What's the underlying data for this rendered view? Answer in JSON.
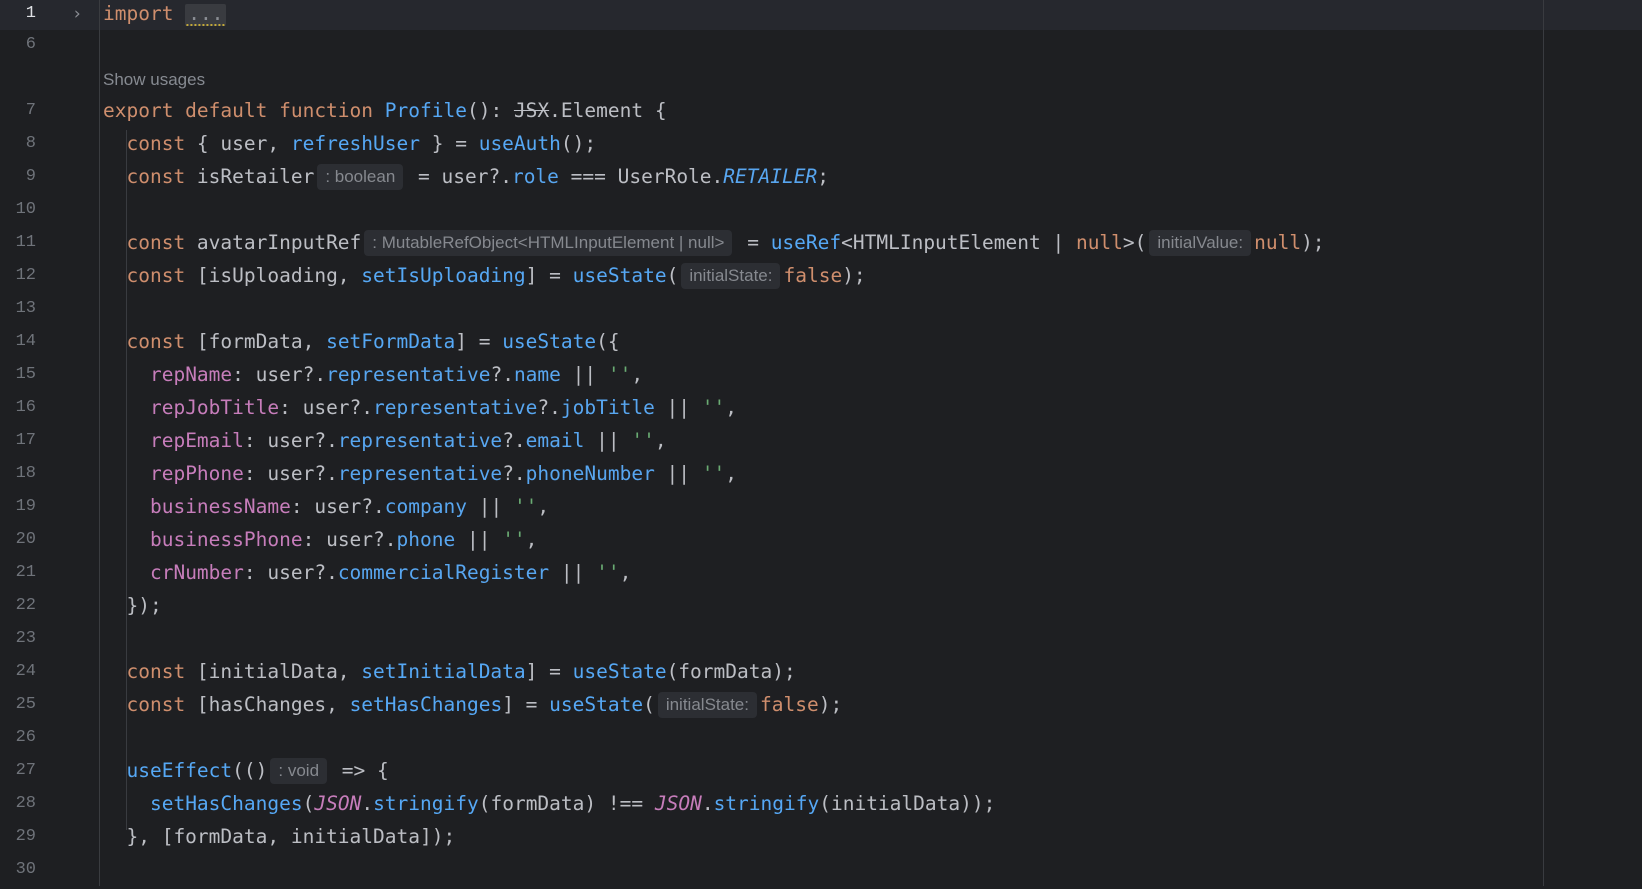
{
  "editor": {
    "code_vision": "Show usages",
    "fold_placeholder": "...",
    "lines": [
      {
        "num": "1",
        "text": "import "
      },
      {
        "num": "6",
        "text": ""
      },
      {
        "num": "7",
        "text": "export default function Profile(): JSX.Element {"
      },
      {
        "num": "8",
        "text": "  const { user, refreshUser } = useAuth();"
      },
      {
        "num": "9",
        "text": "  const isRetailer = user?.role === UserRole.RETAILER;",
        "hint": ": boolean"
      },
      {
        "num": "10",
        "text": ""
      },
      {
        "num": "11",
        "text": "  const avatarInputRef = useRef<HTMLInputElement | null>(null);",
        "hints": [
          ": MutableRefObject<HTMLInputElement | null>",
          "initialValue:"
        ]
      },
      {
        "num": "12",
        "text": "  const [isUploading, setIsUploading] = useState(false);",
        "hint": "initialState:"
      },
      {
        "num": "13",
        "text": ""
      },
      {
        "num": "14",
        "text": "  const [formData, setFormData] = useState({"
      },
      {
        "num": "15",
        "text": "    repName: user?.representative?.name || '',"
      },
      {
        "num": "16",
        "text": "    repJobTitle: user?.representative?.jobTitle || '',"
      },
      {
        "num": "17",
        "text": "    repEmail: user?.representative?.email || '',"
      },
      {
        "num": "18",
        "text": "    repPhone: user?.representative?.phoneNumber || '',"
      },
      {
        "num": "19",
        "text": "    businessName: user?.company || '',"
      },
      {
        "num": "20",
        "text": "    businessPhone: user?.phone || '',"
      },
      {
        "num": "21",
        "text": "    crNumber: user?.commercialRegister || '',"
      },
      {
        "num": "22",
        "text": "  });"
      },
      {
        "num": "23",
        "text": ""
      },
      {
        "num": "24",
        "text": "  const [initialData, setInitialData] = useState(formData);"
      },
      {
        "num": "25",
        "text": "  const [hasChanges, setHasChanges] = useState(false);",
        "hint": "initialState:"
      },
      {
        "num": "26",
        "text": ""
      },
      {
        "num": "27",
        "text": "  useEffect(() => {",
        "hint": ": void"
      },
      {
        "num": "28",
        "text": "    setHasChanges(JSON.stringify(formData) !== JSON.stringify(initialData));"
      },
      {
        "num": "29",
        "text": "  }, [formData, initialData]);"
      },
      {
        "num": "30",
        "text": ""
      }
    ]
  }
}
